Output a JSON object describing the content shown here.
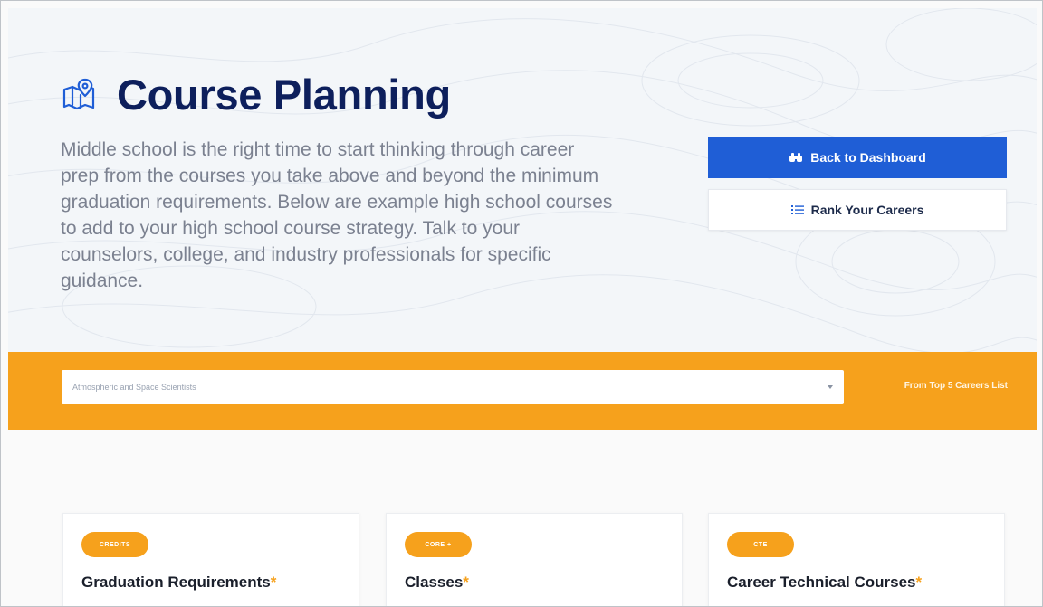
{
  "header": {
    "title": "Course Planning",
    "intro": "Middle school is the right time to start thinking through career prep from the courses you take above and beyond the minimum graduation requirements. Below are example high school courses to add to your high school course strategy. Talk to your counselors, college, and industry professionals for specific guidance.",
    "icon": "map-icon"
  },
  "actions": {
    "back_label": "Back to Dashboard",
    "back_icon": "binoculars-icon",
    "rank_label": "Rank Your Careers",
    "rank_icon": "list-icon"
  },
  "career_bar": {
    "selected_career": "Atmospheric and Space Scientists",
    "top5_link": "From Top 5 Careers List"
  },
  "cards": [
    {
      "badge": "CREDITS",
      "title": "Graduation Requirements",
      "asterisk": "*"
    },
    {
      "badge": "CORE +",
      "title": "Classes",
      "asterisk": "*"
    },
    {
      "badge": "CTE",
      "title": "Career Technical Courses",
      "asterisk": "*"
    }
  ],
  "colors": {
    "primary": "#1f5ed6",
    "accent": "#f6a11c",
    "title": "#0d1f5c"
  }
}
